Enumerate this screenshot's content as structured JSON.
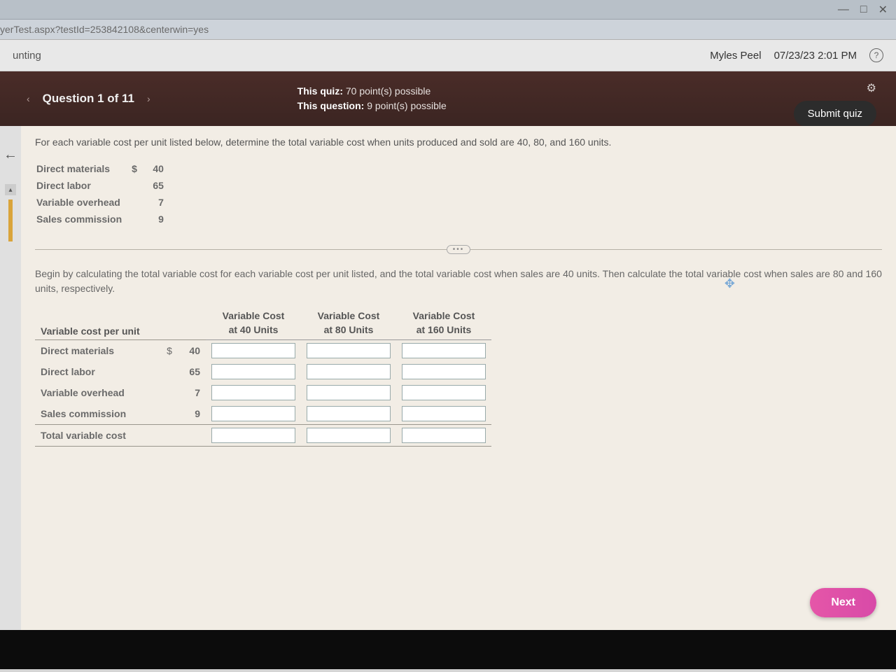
{
  "browser": {
    "url_fragment": "yerTest.aspx?testId=253842108&centerwin=yes"
  },
  "header": {
    "course_fragment": "unting",
    "user_name": "Myles Peel",
    "timestamp": "07/23/23 2:01 PM"
  },
  "quizbar": {
    "question_label": "Question 1 of 11",
    "quiz_points_label": "This quiz:",
    "quiz_points_value": "70 point(s) possible",
    "question_points_label": "This question:",
    "question_points_value": "9 point(s) possible",
    "submit_label": "Submit quiz"
  },
  "question": {
    "prompt": "For each variable cost per unit listed below, determine the total variable cost when units produced and sold are 40, 80, and 160 units.",
    "given": [
      {
        "label": "Direct materials",
        "currency": "$",
        "value": "40"
      },
      {
        "label": "Direct labor",
        "currency": "",
        "value": "65"
      },
      {
        "label": "Variable overhead",
        "currency": "",
        "value": "7"
      },
      {
        "label": "Sales commission",
        "currency": "",
        "value": "9"
      }
    ],
    "instructions": "Begin by calculating the total variable cost for each variable cost per unit listed, and the total variable cost when sales are 40 units. Then calculate the total variable cost when sales are 80 and 160 units, respectively.",
    "grid": {
      "row_header": "Variable cost per unit",
      "col_top": [
        "Variable Cost",
        "Variable Cost",
        "Variable Cost"
      ],
      "col_bottom": [
        "at 40 Units",
        "at 80 Units",
        "at 160 Units"
      ],
      "rows": [
        {
          "label": "Direct materials",
          "currency": "$",
          "unit": "40"
        },
        {
          "label": "Direct labor",
          "currency": "",
          "unit": "65"
        },
        {
          "label": "Variable overhead",
          "currency": "",
          "unit": "7"
        },
        {
          "label": "Sales commission",
          "currency": "",
          "unit": "9"
        },
        {
          "label": "Total variable cost",
          "currency": "",
          "unit": ""
        }
      ]
    }
  },
  "footer": {
    "next_label": "Next"
  }
}
